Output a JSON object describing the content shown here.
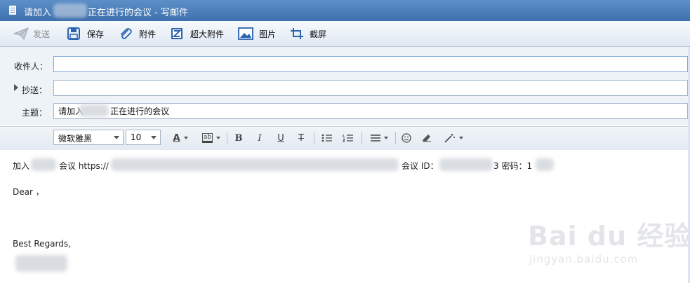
{
  "window": {
    "title_prefix": "请加入",
    "title_suffix": "正在进行的会议 - 写邮件"
  },
  "toolbar": {
    "send": "发送",
    "save": "保存",
    "attach": "附件",
    "large_attach": "超大附件",
    "picture": "图片",
    "screenshot": "截屏"
  },
  "fields": {
    "to_label": "收件人：",
    "cc_label": "抄送：",
    "subject_label": "主题：",
    "to_value": "",
    "cc_value": "",
    "subject_value": "请加入          正在进行的会议"
  },
  "format": {
    "font_family": "微软雅黑",
    "font_size": "10"
  },
  "body": {
    "line1_a": "加入",
    "line1_b": "会议 https://",
    "line1_c": "会议 ID：",
    "line1_d": "3 密码：1",
    "greeting": "Dear ，",
    "closing": "Best Regards,"
  },
  "watermark": {
    "brand": "Bai du 经验",
    "url": "jingyan.baidu.com"
  },
  "colors": {
    "titlebar": "#4a7dbb",
    "toolbar_icon": "#2a63b0",
    "input_border": "#9eb1c8"
  }
}
